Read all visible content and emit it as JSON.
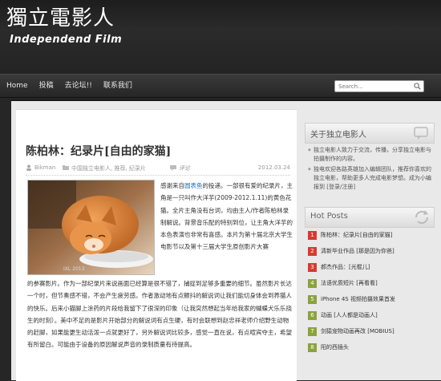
{
  "site": {
    "title": "獨立電影人",
    "subtitle": "Independend Film"
  },
  "nav": {
    "items": [
      "Home",
      "投稿",
      "去论坛!!",
      "联系我们"
    ],
    "search_placeholder": "Search..."
  },
  "post": {
    "title": "陈柏林：纪录片[自由的家猫]",
    "author": "Bikman",
    "categories": "中国独立电影人, 推荐, 纪录片",
    "comments_label": "评论",
    "date": "2012.03.24",
    "para1_pre": "感谢来自",
    "para1_link": "圆表鱼",
    "para1_post": "的投递。一部很有爱的纪录片，主角是一只叫作大洋芋(2009-2012.1.11)的黄色花猫。全片主角没有台词，均由主人/作者陈柏林录制解说。背景音乐配的特别到位，让主角大洋芋的本色表演也非常有喜感。本片为第十届北京大学生电影节以及第十三届大学生原创影片大赛",
    "para2": "的参赛影片。作为一部纪录片来说画面已经算是很不错了，捕捉到足够多重要的细节。虽然影片长达一个时，但节奏感不错，不会产生疲劳感。作者激动地有点颤抖的解说词让我们能切身体会到养猫人的快乐。后来小猫脚上涂药的片段给我留下了很深的印象（让我突然想起当年给我家的蝴蝶犬乐乐挠生的时刻）。美中不足的是影片开始部分的解说词有点生硬，有时会联想到赵忠祥老师介绍野生动物的赶脚，如果能更生动活泼一点就更好了，另外解说词比较多，感觉一直在说，有点喧宾夺主，希望有所留白。可能由于设备的原因解说声音的录制质量有待提高。"
  },
  "sidebar": {
    "about_title": "关于独立电影人",
    "about_lines": [
      "独立电影人致力于交流，传播，分享独立电影与拍摄制作的内容。",
      "独电欢迎各路英雄加入编辑团队，推荐你喜欢的独立电影，帮助更多人完成电影梦想。成为小编报到 [登录/注册]"
    ],
    "hot_title": "Hot Posts",
    "hot_posts": [
      {
        "num": "1",
        "text": "陈柏林：纪录片[自由的家猫]"
      },
      {
        "num": "2",
        "text": "清新毕业作品 [那是因为你爸]"
      },
      {
        "num": "3",
        "text": "郝杰作品：[光棍儿]"
      },
      {
        "num": "4",
        "text": "法语优质短片 [再看看]"
      },
      {
        "num": "5",
        "text": "iPhone 4S 视频拍摄效果首发"
      },
      {
        "num": "6",
        "text": "动画 [人人都是动画人]"
      },
      {
        "num": "7",
        "text": "剑猿宠物动画再改 [MOBIUS]"
      },
      {
        "num": "8",
        "text": "阳的西插头"
      }
    ]
  },
  "colors": {
    "accent_link": "#2a6fb8",
    "hot_badge_red": "#d93a2f",
    "hot_badge_green": "#8aa43a"
  }
}
